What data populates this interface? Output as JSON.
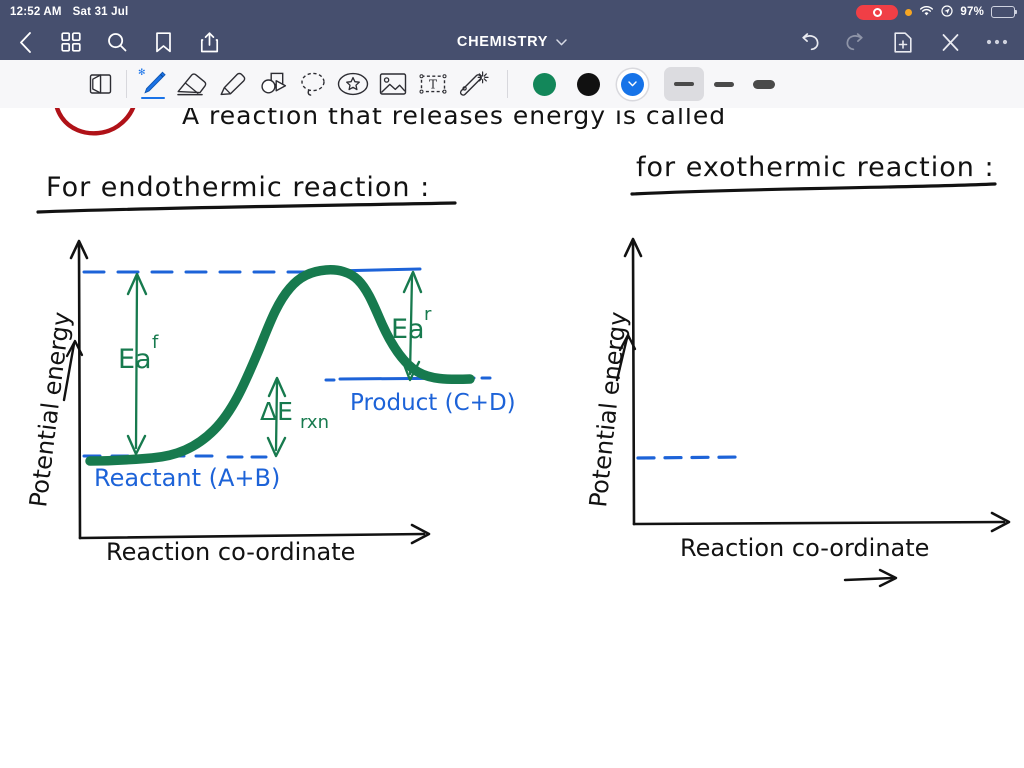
{
  "status_bar": {
    "time": "12:52 AM",
    "date": "Sat 31 Jul",
    "battery_percent": "97%",
    "icons": [
      "screen-recording-indicator",
      "orange-privacy-dot",
      "wifi-icon",
      "location-icon",
      "battery-icon"
    ],
    "background": "#464f6e"
  },
  "nav_bar": {
    "title": "CHEMISTRY",
    "left_icons": [
      "back-chevron-icon",
      "grid-icon",
      "search-icon",
      "bookmark-icon",
      "share-icon"
    ],
    "right_icons": [
      "undo-icon",
      "redo-icon",
      "add-page-icon",
      "close-icon",
      "more-options-icon"
    ],
    "title_chevron": "chevron-down-icon",
    "redo_disabled": true
  },
  "toolbar": {
    "tools": [
      {
        "name": "page-flip-tool",
        "selected": false
      },
      {
        "name": "pen-tool",
        "selected": true,
        "bluetooth": true
      },
      {
        "name": "eraser-tool",
        "selected": false
      },
      {
        "name": "highlighter-tool",
        "selected": false
      },
      {
        "name": "shapes-tool",
        "selected": false
      },
      {
        "name": "lasso-select-tool",
        "selected": false
      },
      {
        "name": "sticker-tool",
        "selected": false
      },
      {
        "name": "image-tool",
        "selected": false
      },
      {
        "name": "text-box-tool",
        "selected": false
      },
      {
        "name": "magic-wand-tool",
        "selected": false
      }
    ],
    "colors": [
      {
        "name": "green-swatch",
        "hex": "#13875a",
        "selected": false
      },
      {
        "name": "black-swatch",
        "hex": "#111111",
        "selected": false
      },
      {
        "name": "blue-swatch",
        "hex": "#1673e8",
        "selected": true
      }
    ],
    "stroke_widths": [
      {
        "name": "thin-stroke",
        "selected": true
      },
      {
        "name": "medium-stroke",
        "selected": false
      },
      {
        "name": "thick-stroke",
        "selected": false
      }
    ],
    "background": "#f7f7f9"
  },
  "notes": {
    "cut_off_line": "A reaction that releases energy is called",
    "heading_left": "For endothermic reaction:",
    "heading_right": "for exothermic reaction:",
    "ink_colors": {
      "black": "#121212",
      "green": "#177a4e",
      "blue": "#1d63d8",
      "red": "#b01218"
    }
  },
  "chart_data": [
    {
      "type": "line",
      "name": "endothermic-energy-diagram",
      "title": "For endothermic reaction:",
      "xlabel": "Reaction co-ordinate",
      "ylabel": "Potential energy",
      "ylim": [
        0,
        100
      ],
      "xlim": [
        0,
        100
      ],
      "grid": false,
      "legend": "none",
      "x": [
        0,
        6,
        13,
        20,
        27,
        34,
        41,
        48,
        55,
        62,
        69,
        76,
        83,
        90,
        100
      ],
      "y": [
        14,
        14,
        15,
        20,
        32,
        52,
        72,
        86,
        90,
        90,
        86,
        70,
        50,
        42,
        41
      ],
      "annotations": [
        {
          "name": "reactant-label",
          "text": "Reactant (A+B)",
          "color": "#1d63d8",
          "level": 14
        },
        {
          "name": "product-label",
          "text": "Product (C+D)",
          "color": "#1d63d8",
          "level": 41
        },
        {
          "name": "forward-activation-energy",
          "text": "Ea",
          "superscript": "f",
          "color": "#177a4e",
          "from": 14,
          "to": 90
        },
        {
          "name": "reverse-activation-energy",
          "text": "Ea",
          "superscript": "r",
          "color": "#177a4e",
          "from": 41,
          "to": 90
        },
        {
          "name": "enthalpy-change",
          "text": "ΔE",
          "subscript": "rxn",
          "color": "#177a4e",
          "from": 14,
          "to": 41
        }
      ],
      "dashed_levels": [
        {
          "name": "reactant-level-line",
          "value": 14,
          "color": "#1d63d8",
          "style": "dashed"
        },
        {
          "name": "transition-state-level-line",
          "value": 90,
          "color": "#1d63d8",
          "style": "dashed"
        },
        {
          "name": "product-level-line",
          "value": 41,
          "color": "#1d63d8",
          "style": "solid"
        }
      ],
      "curve_color": "#177a4e"
    },
    {
      "type": "line",
      "name": "exothermic-energy-diagram",
      "title": "for exothermic reaction:",
      "xlabel": "Reaction co-ordinate",
      "ylabel": "Potential energy",
      "xlabel_arrow": "→",
      "ylabel_arrow": "→",
      "ylim": [
        0,
        100
      ],
      "xlim": [
        0,
        100
      ],
      "grid": false,
      "legend": "none",
      "x": [],
      "y": [],
      "annotations": [],
      "dashed_levels": [
        {
          "name": "reactant-level-line",
          "value": 30,
          "color": "#1d63d8",
          "style": "dashed"
        }
      ],
      "curve_color": "#177a4e",
      "note": "blank template — curve not yet drawn"
    }
  ]
}
